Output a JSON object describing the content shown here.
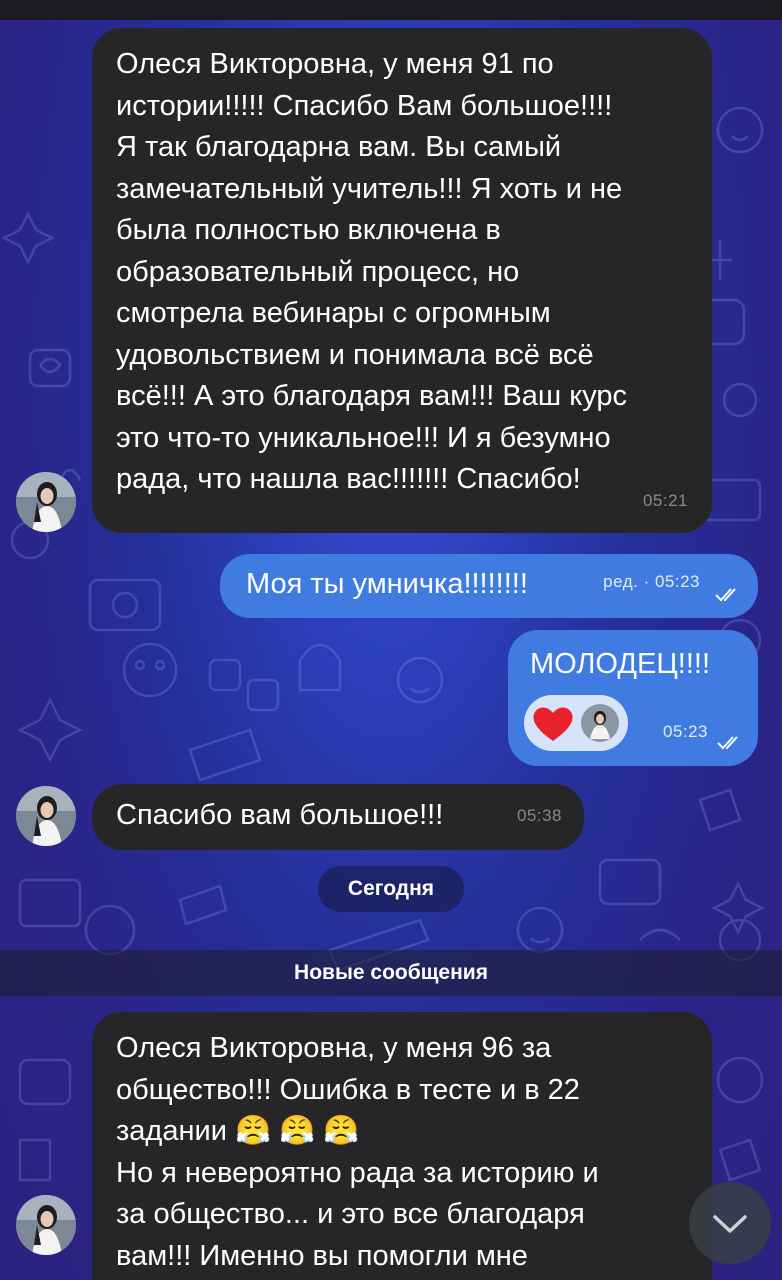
{
  "messages": [
    {
      "direction": "incoming",
      "text": "Олеся Викторовна, у меня 91 по\nистории!!!!! Спасибо Вам большое!!!!\nЯ так благодарна вам. Вы самый\nзамечательный учитель!!! Я хоть и не\nбыла полностью включена в\nобразовательный процесс, но\nсмотрела вебинары с огромным\nудовольствием и понимала всё всё\nвсё!!! А это благодаря вам!!! Ваш курс\nэто что-то уникальное!!! И я безумно\nрада, что нашла вас!!!!!!! Спасибо!",
      "time": "05:21"
    },
    {
      "direction": "outgoing",
      "text": "Моя ты умничка!!!!!!!!",
      "time": "ред. · 05:23"
    },
    {
      "direction": "outgoing",
      "text": "МОЛОДЕЦ!!!!",
      "time": "05:23",
      "reaction": "heart-emoji"
    },
    {
      "direction": "incoming",
      "text": "Спасибо вам большое!!!",
      "time": "05:38"
    },
    {
      "direction": "incoming",
      "text": "Олеся Викторовна, у меня 96 за\nобщество!!! Ошибка в тесте и в 22\nзадании 😤 😤 😤\nНо я невероятно рада за историю и\nза общество... и это все благодаря\nвам!!! Именно вы помогли мне"
    }
  ],
  "date_separator": "Сегодня",
  "new_messages_label": "Новые сообщения",
  "colors": {
    "incoming_bubble": "#262628",
    "outgoing_bubble": "#3f7be0",
    "background_top": "#3b52d6",
    "background_bottom": "#2e2280"
  },
  "icons": {
    "read_receipt": "double-check-icon",
    "scroll_down": "chevron-down-icon"
  }
}
